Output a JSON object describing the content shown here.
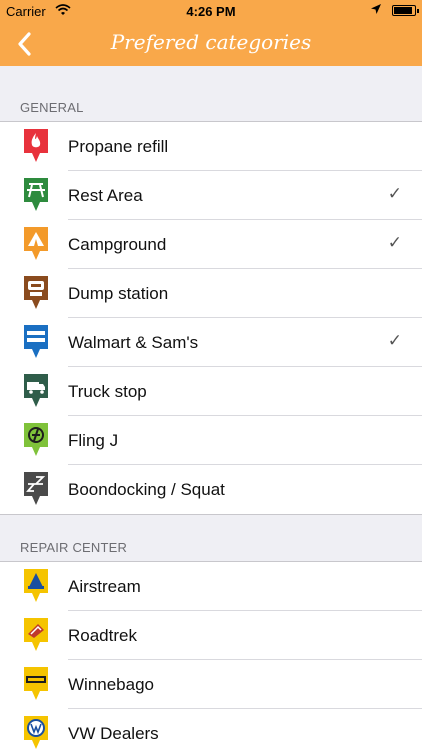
{
  "status": {
    "carrier": "Carrier",
    "time": "4:26 PM"
  },
  "nav": {
    "title": "Prefered categories"
  },
  "sections": [
    {
      "header": "GENERAL",
      "rows": [
        {
          "label": "Propane refill",
          "checked": false,
          "icon": "flame-icon",
          "color": "#e8323c"
        },
        {
          "label": "Rest Area",
          "checked": true,
          "icon": "picnic-table-icon",
          "color": "#2e8b3e"
        },
        {
          "label": "Campground",
          "checked": true,
          "icon": "tent-icon",
          "color": "#f39a2a"
        },
        {
          "label": "Dump station",
          "checked": false,
          "icon": "dump-station-icon",
          "color": "#8a4b1e"
        },
        {
          "label": "Walmart & Sam's",
          "checked": true,
          "icon": "walmart-icon",
          "color": "#1a6fc2"
        },
        {
          "label": "Truck stop",
          "checked": false,
          "icon": "truck-icon",
          "color": "#2f5d4a"
        },
        {
          "label": "Fling J",
          "checked": false,
          "icon": "fling-j-icon",
          "color": "#7fc23a"
        },
        {
          "label": "Boondocking / Squat",
          "checked": false,
          "icon": "sleep-icon",
          "color": "#4a4a4a"
        }
      ]
    },
    {
      "header": "REPAIR CENTER",
      "rows": [
        {
          "label": "Airstream",
          "checked": false,
          "icon": "airstream-icon",
          "color": "#f5c400"
        },
        {
          "label": "Roadtrek",
          "checked": false,
          "icon": "roadtrek-icon",
          "color": "#f5c400"
        },
        {
          "label": "Winnebago",
          "checked": false,
          "icon": "winnebago-icon",
          "color": "#f5c400"
        },
        {
          "label": "VW Dealers",
          "checked": false,
          "icon": "vw-icon",
          "color": "#f5c400"
        }
      ]
    }
  ],
  "check_glyph": "✓",
  "back_glyph": "‹"
}
